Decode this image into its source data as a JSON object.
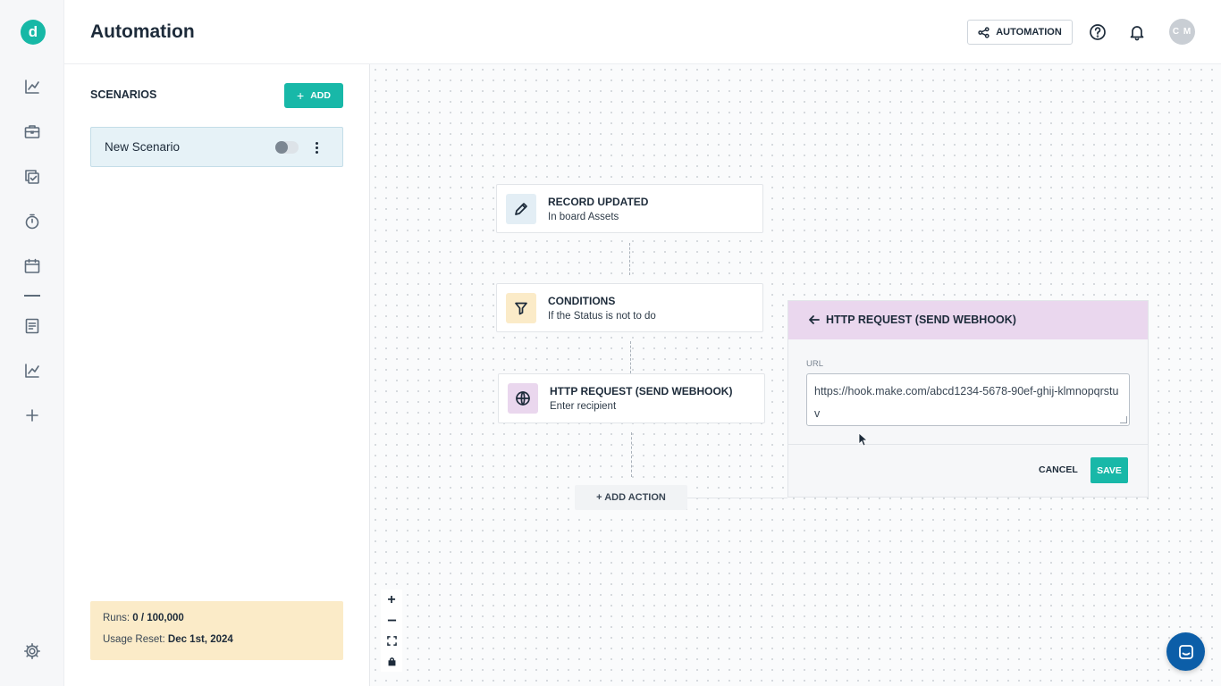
{
  "app": {
    "logo_letter": "d",
    "page_title": "Automation"
  },
  "header": {
    "automation_button": "AUTOMATION",
    "avatar_initials": "C M"
  },
  "rail": {
    "icons": [
      "analytics-icon",
      "briefcase-icon",
      "task-copy-icon",
      "timer-icon",
      "calendar-icon",
      "document-icon",
      "chart-icon",
      "plus-icon",
      "settings-icon"
    ]
  },
  "scenarios": {
    "title": "SCENARIOS",
    "add_label": "ADD",
    "items": [
      {
        "name": "New Scenario",
        "enabled": false
      }
    ]
  },
  "usage": {
    "runs_label": "Runs:",
    "runs_value": "0 / 100,000",
    "reset_label": "Usage Reset:",
    "reset_value": "Dec 1st, 2024"
  },
  "flow": {
    "nodes": [
      {
        "title": "RECORD UPDATED",
        "subtitle": "In board Assets",
        "icon": "pencil-icon",
        "icon_bg": "#e3eef5"
      },
      {
        "title": "CONDITIONS",
        "subtitle": "If the Status is not to do",
        "icon": "filter-icon",
        "icon_bg": "#fbebc8"
      },
      {
        "title": "HTTP REQUEST (SEND WEBHOOK)",
        "subtitle": "Enter recipient",
        "icon": "globe-icon",
        "icon_bg": "#ead7ee"
      }
    ],
    "add_action_label": "+ ADD ACTION"
  },
  "editor": {
    "title": "HTTP REQUEST (SEND WEBHOOK)",
    "url_label": "URL",
    "url_value": "https://hook.make.com/abcd1234-5678-90ef-ghij-klmnopqrstuv",
    "cancel_label": "CANCEL",
    "save_label": "SAVE"
  },
  "colors": {
    "brand": "#18b8a8",
    "editor_header": "#ead7ee",
    "usage_bg": "#fbebc8",
    "chat_button": "#0c5ea8"
  }
}
